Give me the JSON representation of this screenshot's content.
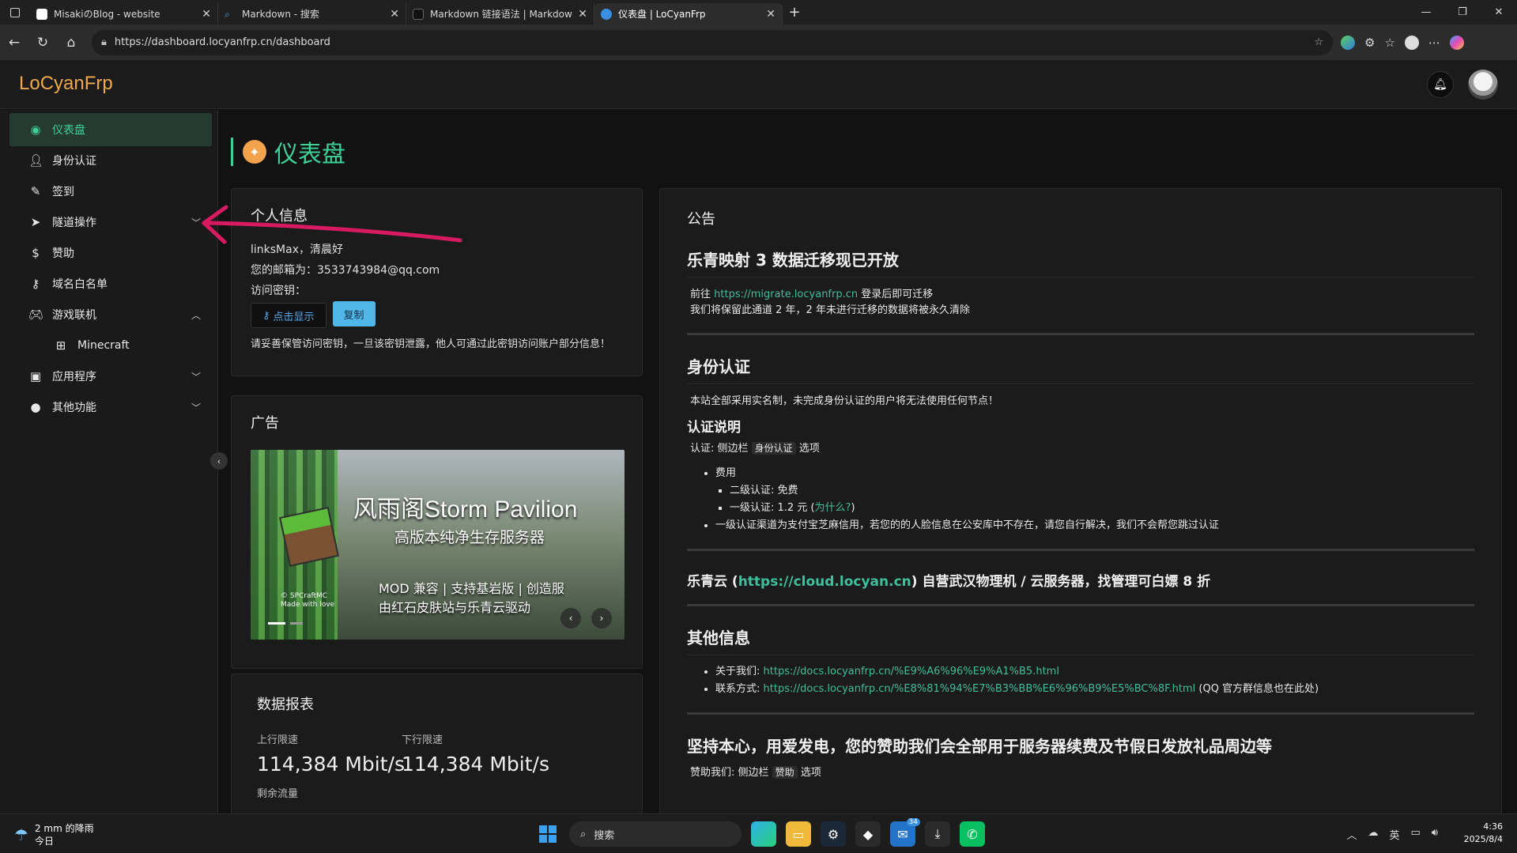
{
  "browser": {
    "tabs": [
      {
        "title": "MisakiのBlog - website",
        "fav_color": "#ffffff"
      },
      {
        "title": "Markdown - 搜索",
        "fav_color": "#3a8fe0"
      },
      {
        "title": "Markdown 链接语法 | Markdown",
        "fav_color": "#222222"
      },
      {
        "title": "仪表盘 | LoCyanFrp",
        "fav_color": "#3a8fe0"
      }
    ],
    "url": "https://dashboard.locyanfrp.cn/dashboard"
  },
  "app": {
    "logo": "LoCyanFrp"
  },
  "sidebar": {
    "items": [
      {
        "label": "仪表盘",
        "icon": "compass-icon"
      },
      {
        "label": "身份认证",
        "icon": "person-icon"
      },
      {
        "label": "签到",
        "icon": "pencil-icon"
      },
      {
        "label": "隧道操作",
        "icon": "paper-plane-icon"
      },
      {
        "label": "赞助",
        "icon": "dollar-icon"
      },
      {
        "label": "域名白名单",
        "icon": "key-icon"
      },
      {
        "label": "游戏联机",
        "icon": "gamepad-icon"
      },
      {
        "label": "Minecraft",
        "icon": "tree-icon"
      },
      {
        "label": "应用程序",
        "icon": "box-icon"
      },
      {
        "label": "其他功能",
        "icon": "more-icon"
      }
    ]
  },
  "page": {
    "title": "仪表盘"
  },
  "info": {
    "title": "个人信息",
    "greeting": "linksMax，清晨好",
    "email": "您的邮箱为：3533743984@qq.com",
    "key_label": "访问密钥：",
    "show_btn": "点击显示",
    "copy_btn": "复制",
    "warning": "请妥善保管访问密钥，一旦该密钥泄露，他人可通过此密钥访问账户部分信息！"
  },
  "ad": {
    "title": "广告",
    "banner_title": "风雨阁Storm Pavilion",
    "banner_sub": "高版本纯净生存服务器",
    "banner_line1": "MOD 兼容 | 支持基岩版 | 创造服",
    "banner_line2": "由红石皮肤站与乐青云驱动",
    "banner_copy1": "© SPCraftMC",
    "banner_copy2": "Made with love"
  },
  "stats": {
    "title": "数据报表",
    "up_label": "上行限速",
    "down_label": "下行限速",
    "up_value": "114,384 Mbit/s",
    "down_value": "114,384 Mbit/s",
    "remain_label": "剩余流量"
  },
  "notice": {
    "title": "公告",
    "s1_title": "乐青映射 3 数据迁移现已开放",
    "s1_p1_pre": "前往",
    "s1_link": "https://migrate.locyanfrp.cn",
    "s1_p1_post": "登录后即可迁移",
    "s1_p2": "我们将保留此通道 2 年，2 年未进行迁移的数据将被永久清除",
    "s2_title": "身份认证",
    "s2_p": "本站全部采用实名制，未完成身份认证的用户将无法使用任何节点！",
    "s2_sub": "认证说明",
    "s2_path_pre": "认证: 侧边栏",
    "s2_path_kbd": "身份认证",
    "s2_path_post": "选项",
    "fee": "费用",
    "fee2": "二级认证: 免费",
    "fee1_pre": "一级认证: 1.2 元 (",
    "fee1_link": "为什么?",
    "fee1_post": ")",
    "fee_note": "一级认证渠道为支付宝芝麻信用，若您的的人脸信息在公安库中不存在，请您自行解决，我们不会帮您跳过认证",
    "s3_pre": "乐青云 (",
    "s3_link": "https://cloud.locyan.cn",
    "s3_post": ") 自营武汉物理机 / 云服务器，找管理可白嫖 8 折",
    "s4_title": "其他信息",
    "about_label": "关于我们: ",
    "about_link": "https://docs.locyanfrp.cn/%E9%A6%96%E9%A1%B5.html",
    "contact_label": "联系方式: ",
    "contact_link": "https://docs.locyanfrp.cn/%E8%81%94%E7%B3%BB%E6%96%B9%E5%BC%8F.html",
    "contact_post": "(QQ 官方群信息也在此处)",
    "s5_title": "坚持本心，用爱发电，您的赞助我们会全部用于服务器续费及节假日发放礼品周边等",
    "s5_pre": "赞助我们: 侧边栏",
    "s5_kbd": "赞助",
    "s5_post": "选项"
  },
  "taskbar": {
    "weather1": "2 mm 的降雨",
    "weather2": "今日",
    "search": "搜索",
    "badge": "34",
    "lang": "英",
    "time": "4:36",
    "date": "2025/8/4"
  }
}
